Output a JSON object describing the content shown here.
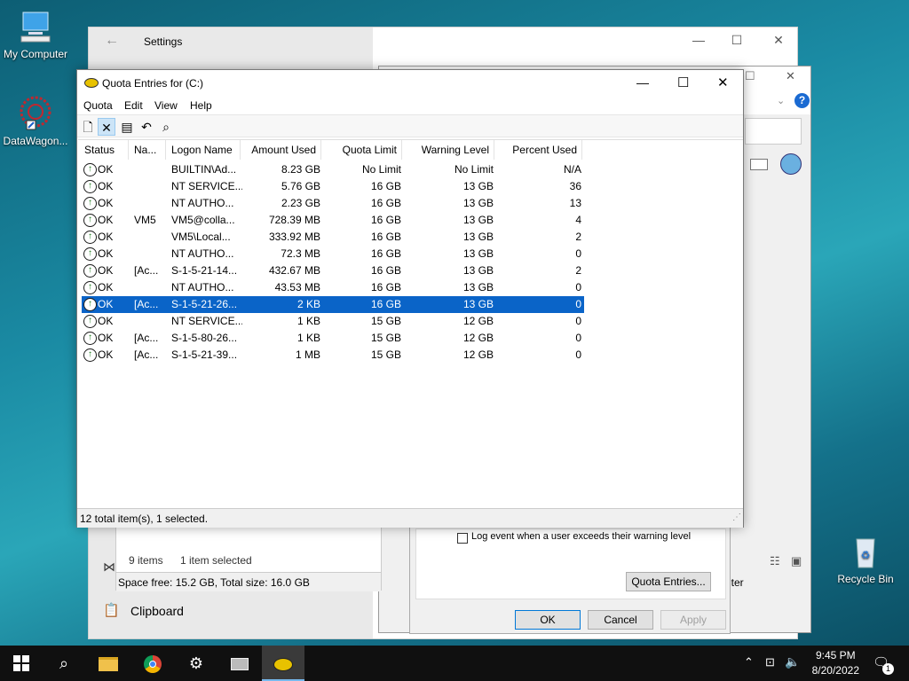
{
  "desktop": {
    "icons": [
      {
        "label": "My Computer"
      },
      {
        "label": "DataWagon..."
      },
      {
        "label": "Recycle Bin"
      }
    ]
  },
  "settings_window": {
    "title": "Settings",
    "clipboard_label": "Clipboard"
  },
  "explorer_window": {
    "items_count": "9 items",
    "selected_count": "1 item selected",
    "space_text": "Space free: 15.2 GB, Total size: 16.0 GB",
    "partial_text": "uter"
  },
  "properties_dialog": {
    "log_event_label": "Log event when a user exceeds their warning level",
    "quota_entries_button": "Quota Entries...",
    "ok_button": "OK",
    "cancel_button": "Cancel",
    "apply_button": "Apply"
  },
  "quota_window": {
    "title": "Quota Entries for  (C:)",
    "menu": [
      "Quota",
      "Edit",
      "View",
      "Help"
    ],
    "columns": [
      "Status",
      "Na...",
      "Logon Name",
      "Amount Used",
      "Quota Limit",
      "Warning Level",
      "Percent Used"
    ],
    "rows": [
      {
        "status": "OK",
        "name": "",
        "logon": "BUILTIN\\Ad...",
        "amount": "8.23 GB",
        "limit": "No Limit",
        "warning": "No Limit",
        "percent": "N/A",
        "selected": false
      },
      {
        "status": "OK",
        "name": "",
        "logon": "NT SERVICE...",
        "amount": "5.76 GB",
        "limit": "16 GB",
        "warning": "13 GB",
        "percent": "36",
        "selected": false
      },
      {
        "status": "OK",
        "name": "",
        "logon": "NT AUTHO...",
        "amount": "2.23 GB",
        "limit": "16 GB",
        "warning": "13 GB",
        "percent": "13",
        "selected": false
      },
      {
        "status": "OK",
        "name": "VM5",
        "logon": "VM5@colla...",
        "amount": "728.39 MB",
        "limit": "16 GB",
        "warning": "13 GB",
        "percent": "4",
        "selected": false
      },
      {
        "status": "OK",
        "name": "",
        "logon": "VM5\\Local...",
        "amount": "333.92 MB",
        "limit": "16 GB",
        "warning": "13 GB",
        "percent": "2",
        "selected": false
      },
      {
        "status": "OK",
        "name": "",
        "logon": "NT AUTHO...",
        "amount": "72.3 MB",
        "limit": "16 GB",
        "warning": "13 GB",
        "percent": "0",
        "selected": false
      },
      {
        "status": "OK",
        "name": "[Ac...",
        "logon": "S-1-5-21-14...",
        "amount": "432.67 MB",
        "limit": "16 GB",
        "warning": "13 GB",
        "percent": "2",
        "selected": false
      },
      {
        "status": "OK",
        "name": "",
        "logon": "NT AUTHO...",
        "amount": "43.53 MB",
        "limit": "16 GB",
        "warning": "13 GB",
        "percent": "0",
        "selected": false
      },
      {
        "status": "OK",
        "name": "[Ac...",
        "logon": "S-1-5-21-26...",
        "amount": "2 KB",
        "limit": "16 GB",
        "warning": "13 GB",
        "percent": "0",
        "selected": true
      },
      {
        "status": "OK",
        "name": "",
        "logon": "NT SERVICE...",
        "amount": "1 KB",
        "limit": "15 GB",
        "warning": "12 GB",
        "percent": "0",
        "selected": false
      },
      {
        "status": "OK",
        "name": "[Ac...",
        "logon": "S-1-5-80-26...",
        "amount": "1 KB",
        "limit": "15 GB",
        "warning": "12 GB",
        "percent": "0",
        "selected": false
      },
      {
        "status": "OK",
        "name": "[Ac...",
        "logon": "S-1-5-21-39...",
        "amount": "1 MB",
        "limit": "15 GB",
        "warning": "12 GB",
        "percent": "0",
        "selected": false
      }
    ],
    "status_text": "12 total item(s), 1 selected."
  },
  "taskbar": {
    "time": "9:45 PM",
    "date": "8/20/2022",
    "notification_count": "1"
  }
}
